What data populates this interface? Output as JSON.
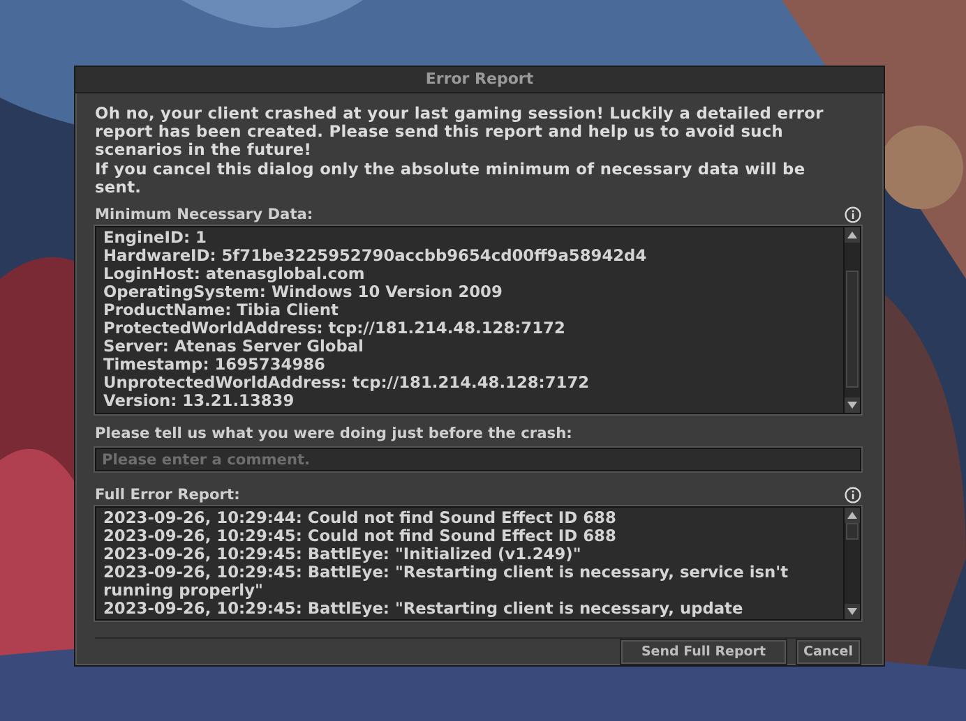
{
  "dialog": {
    "title": "Error Report",
    "intro": [
      "Oh no, your client crashed at your last gaming session! Luckily a detailed error report has been created. Please send this report and help us to avoid such scenarios in the future!",
      "If you cancel this dialog only the absolute minimum of necessary data will be sent."
    ],
    "minimum_data": {
      "label": "Minimum Necessary Data:",
      "lines": [
        "EngineID: 1",
        "HardwareID: 5f71be3225952790accbb9654cd00ff9a58942d4",
        "LoginHost: atenasglobal.com",
        "OperatingSystem: Windows 10 Version 2009",
        "ProductName: Tibia Client",
        "ProtectedWorldAddress: tcp://181.214.48.128:7172",
        "Server: Atenas Server Global",
        "Timestamp: 1695734986",
        "UnprotectedWorldAddress: tcp://181.214.48.128:7172",
        "Version: 13.21.13839"
      ]
    },
    "comment": {
      "label": "Please tell us what you were doing just before the crash:",
      "placeholder": "Please enter a comment."
    },
    "full_report": {
      "label": "Full Error Report:",
      "lines": [
        "2023-09-26, 10:29:44: Could not find Sound Effect ID 688",
        "2023-09-26, 10:29:45: Could not find Sound Effect ID 688",
        "2023-09-26, 10:29:45: BattlEye: \"Initialized (v1.249)\"",
        "2023-09-26, 10:29:45: BattlEye: \"Restarting client is necessary, service isn't running properly\"",
        "2023-09-26, 10:29:45: BattlEye: \"Restarting client is necessary, update"
      ]
    },
    "buttons": [
      "Send Full Report",
      "Cancel"
    ]
  }
}
